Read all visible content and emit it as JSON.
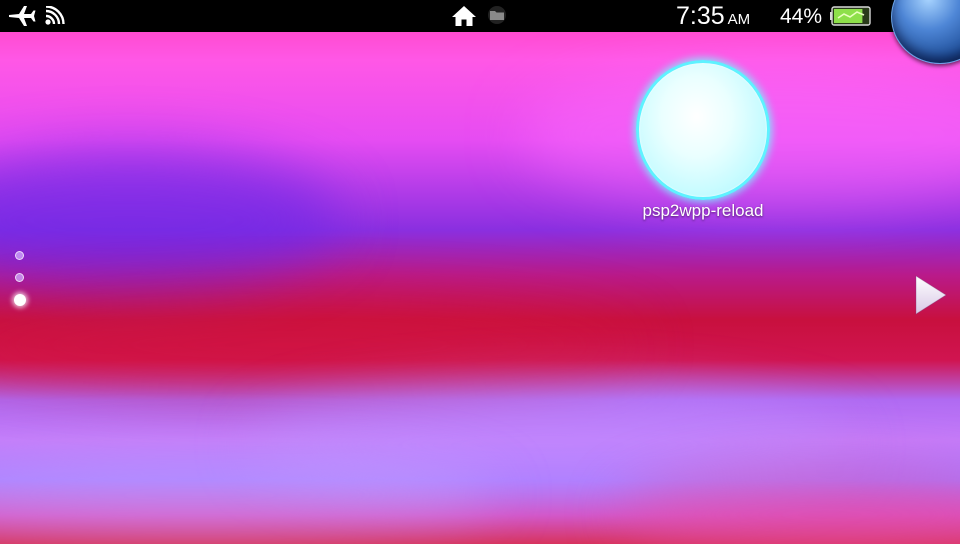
{
  "status_bar": {
    "icons": {
      "left": [
        "airplane-icon",
        "wifi-icon"
      ],
      "center": [
        "home-icon",
        "folder-icon"
      ],
      "right": [
        "battery-icon"
      ]
    },
    "time": "7:35",
    "ampm": "AM",
    "battery_percent": "44%",
    "battery_level": 0.44
  },
  "home": {
    "apps": [
      {
        "label": "psp2wpp-reload"
      }
    ],
    "pages": {
      "count": 3,
      "active_index": 2
    }
  },
  "colors": {
    "bubble_glow": "#5ef2ff",
    "battery_fill": "#8ee04a",
    "power_orb": "#4e86d6"
  }
}
